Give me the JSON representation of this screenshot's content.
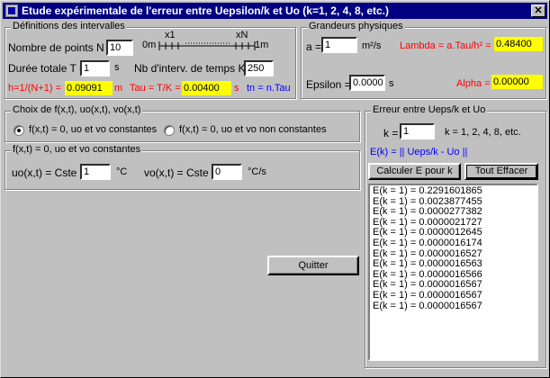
{
  "title": "Etude expérimentale de l'erreur entre Uepsilon/k et Uo (k=1, 2, 4, 8,  etc.)",
  "close_glyph": "✕",
  "intervals": {
    "group_label": "Définitions des intervalles",
    "n_label": "Nombre de points  N =",
    "n_value": "10",
    "ruler_x1": "x1",
    "ruler_xN": "xN",
    "ruler_0m": "0m",
    "ruler_1m": "1m",
    "t_label": "Durée totale T =",
    "t_value": "1",
    "t_unit": "s",
    "k_label": "Nb d'interv. de temps K =",
    "k_value": "250",
    "h_label": "h=1/(N+1) =",
    "h_value": "0.09091",
    "h_unit": "m",
    "tau_label": "Tau = T/K =",
    "tau_value": "0.00400",
    "tau_unit": "s",
    "tn_label": "tn = n.Tau"
  },
  "physics": {
    "group_label": "Grandeurs physiques",
    "a_label": "a =",
    "a_value": "1",
    "a_unit": "m²/s",
    "lambda_label": "Lambda = a.Tau/h² =",
    "lambda_value": "0.48400",
    "eps_label": "Epsilon =",
    "eps_value": "0.0000",
    "eps_unit": "s",
    "alpha_label": "Alpha =",
    "alpha_value": "0.00000"
  },
  "choice": {
    "group_label": "Choix de f(x,t), uo(x,t), vo(x,t)",
    "opt1": "f(x,t) = 0, uo et vo constantes",
    "opt2": "f(x,t) = 0, uo et vo non constantes"
  },
  "constants": {
    "group_label": "f(x,t) = 0, uo et vo constantes",
    "uo_label": "uo(x,t) = Cste =",
    "uo_value": "1",
    "uo_unit": "°C",
    "vo_label": "vo(x,t) = Cste =",
    "vo_value": "0",
    "vo_unit": "°C/s"
  },
  "error": {
    "group_label": "Erreur entre Ueps/k et Uo",
    "k_label": "k =",
    "k_value": "1",
    "k_hint": "k = 1, 2, 4, 8, etc.",
    "formula": "E(k) = || Ueps/k - Uo ||",
    "calc_button": "Calculer E pour k",
    "clear_button": "Tout Effacer",
    "results": [
      "E(k = 1) = 0.2291601865",
      "E(k = 1) = 0.0023877455",
      "E(k = 1) = 0.0000277382",
      "E(k = 1) = 0.0000021727",
      "E(k = 1) = 0.0000012645",
      "E(k = 1) = 0.0000016174",
      "E(k = 1) = 0.0000016527",
      "E(k = 1) = 0.0000016563",
      "E(k = 1) = 0.0000016566",
      "E(k = 1) = 0.0000016567",
      "E(k = 1) = 0.0000016567",
      "E(k = 1) = 0.0000016567"
    ]
  },
  "quit_button": "Quitter"
}
